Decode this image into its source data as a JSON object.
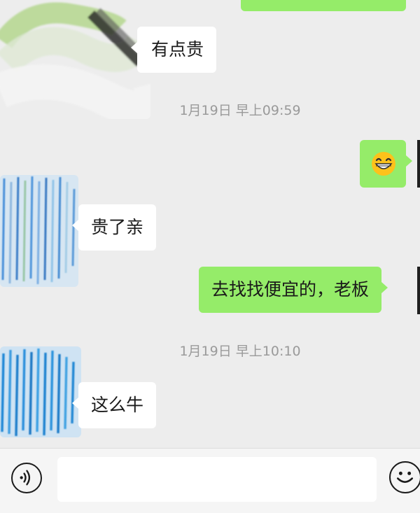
{
  "chat": {
    "messages": [
      {
        "side": "left",
        "text": "有点贵"
      },
      {
        "side": "timestamp",
        "text": "1月19日 早上09:59"
      },
      {
        "side": "right",
        "emoji": "grinning-face-with-smiling-eyes"
      },
      {
        "side": "left",
        "text": "贵了亲"
      },
      {
        "side": "right",
        "text": "去找找便宜的，老板"
      },
      {
        "side": "timestamp",
        "text": "1月19日 早上10:10"
      },
      {
        "side": "left",
        "text": "这么牛"
      }
    ]
  },
  "input_bar": {
    "voice_icon": "voice-icon",
    "text_value": "",
    "emoji_icon": "emoji-icon"
  },
  "colors": {
    "background": "#ededed",
    "bubble_self": "#95ec69",
    "bubble_other": "#ffffff",
    "timestamp": "#9a9a9a"
  }
}
